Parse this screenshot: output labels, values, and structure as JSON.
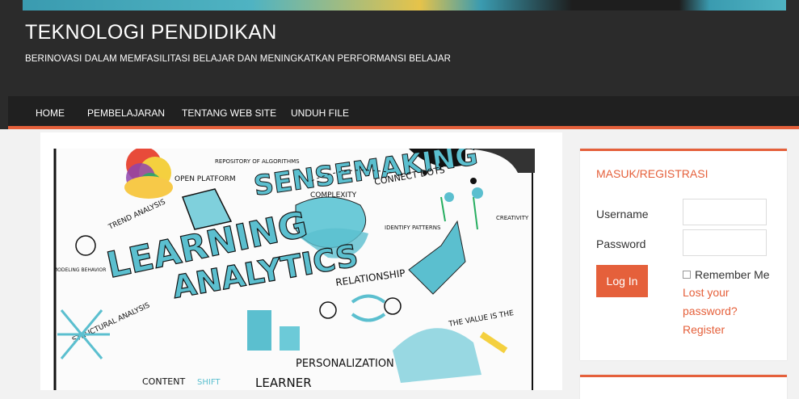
{
  "header": {
    "title": "TEKNOLOGI PENDIDIKAN",
    "tagline": "BERINOVASI DALAM MEMFASILITASI BELAJAR DAN MENINGKATKAN PERFORMANSI BELAJAR"
  },
  "nav": {
    "items": [
      {
        "label": "HOME"
      },
      {
        "label": "PEMBELAJARAN"
      },
      {
        "label": "TENTANG WEB SITE"
      },
      {
        "label": "UNDUH FILE"
      }
    ]
  },
  "featured": {
    "words": {
      "sensemaking": "SENSEMAKING",
      "learning": "LEARNING",
      "analytics": "ANALYTICS",
      "complexity": "COMPLEXITY",
      "connect_dots": "CONNECT DOTS",
      "open_platform": "OPEN PLATFORM",
      "repository": "REPOSITORY OF ALGORITHMS",
      "trend": "TREND ANALYSIS",
      "relationship": "RELATIONSHIP",
      "personalization": "PERSONALIZATION",
      "structural": "STRUCTURAL ANALYSIS",
      "content": "CONTENT",
      "shift": "SHIFT",
      "learner": "LEARNER",
      "modeling": "MODELING BEHAVIOR",
      "identify": "IDENTIFY PATTERNS",
      "creativity": "CREATIVITY",
      "value": "THE VALUE IS THE"
    }
  },
  "login_widget": {
    "title": "MASUK/REGISTRASI",
    "username_label": "Username",
    "password_label": "Password",
    "login_button": "Log In",
    "remember_label": "Remember Me",
    "lost_password_line1": "Lost your",
    "lost_password_line2": "password?",
    "register": "Register"
  },
  "colors": {
    "accent": "#e5603b",
    "header_bg": "#2b2b2b",
    "nav_bg": "#202020"
  }
}
